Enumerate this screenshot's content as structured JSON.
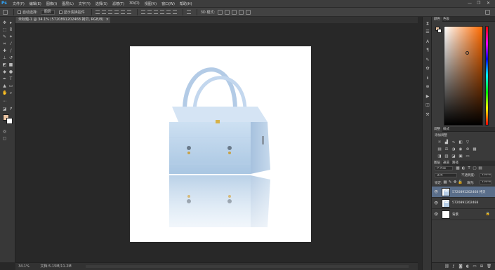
{
  "app": {
    "logo": "Ps"
  },
  "menu": [
    "文件(F)",
    "编辑(E)",
    "图像(I)",
    "图层(L)",
    "文字(Y)",
    "选择(S)",
    "滤镜(T)",
    "3D(D)",
    "视图(V)",
    "窗口(W)",
    "帮助(H)"
  ],
  "window_controls": {
    "minimize": "—",
    "restore": "❐",
    "close": "✕"
  },
  "options": {
    "auto_select_label": "自动选择:",
    "auto_select_value": "图层",
    "show_transform_label": "显示变换控件",
    "mode_3d_label": "3D 模式:"
  },
  "document": {
    "tab_title": "未标题-1 @ 34.1% (5720891202468 拷贝, RGB/8)",
    "tab_close": "×"
  },
  "status": {
    "zoom": "34.1%",
    "doc_size": "文档:5.15M/11.2M"
  },
  "colors": {
    "foreground": "#e9c3a2",
    "background": "#ffffff"
  },
  "panels": {
    "color_tabs": [
      "颜色",
      "色板"
    ],
    "adjust_tabs": [
      "调整",
      "样式"
    ],
    "adjust_title": "添加调整",
    "layer_tabs": [
      "图层",
      "通道",
      "路径"
    ],
    "kind_filter": "ρ 类型",
    "blend_mode": "正常",
    "opacity_label": "不透明度:",
    "opacity_value": "100%",
    "lock_label": "锁定:",
    "fill_label": "填充:",
    "fill_value": "100%",
    "layers": [
      {
        "name": "5720891202468 拷贝",
        "selected": true,
        "locked": false
      },
      {
        "name": "5720891202468",
        "selected": false,
        "locked": false
      },
      {
        "name": "背景",
        "selected": false,
        "locked": true
      }
    ]
  }
}
